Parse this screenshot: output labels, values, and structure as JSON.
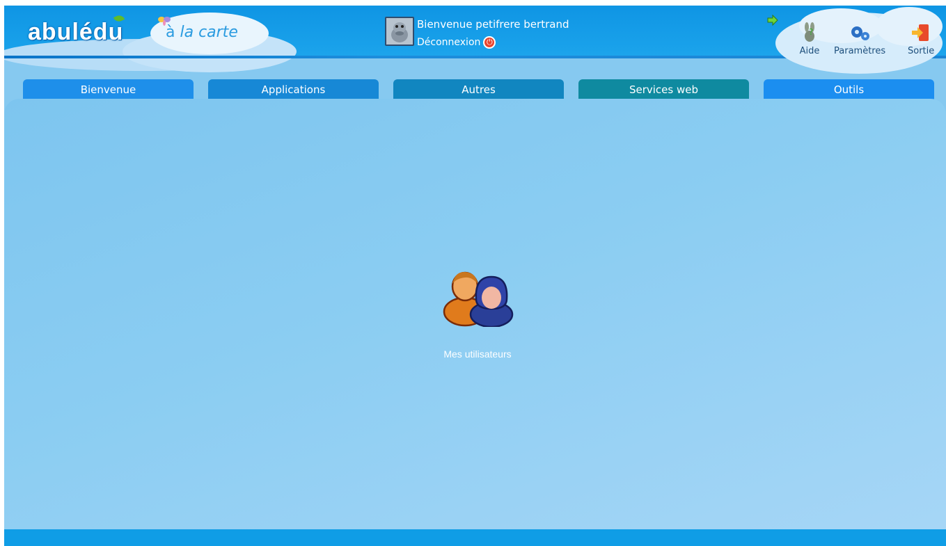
{
  "brand": {
    "logo_text": "abulédu",
    "subtitle_a": "à",
    "subtitle_rest": " la carte"
  },
  "user": {
    "greeting": "Bienvenue petifrere bertrand",
    "logout_label": "Déconnexion"
  },
  "toolbar": {
    "aide_label": "Aide",
    "parametres_label": "Paramètres",
    "sortie_label": "Sortie"
  },
  "nav": {
    "tabs": [
      {
        "label": "Bienvenue",
        "color": "#1e8fea"
      },
      {
        "label": "Applications",
        "color": "#1788d6"
      },
      {
        "label": "Autres",
        "color": "#1186c0"
      },
      {
        "label": "Services web",
        "color": "#0f8aa0"
      },
      {
        "label": "Outils",
        "color": "#1b8ef0"
      }
    ]
  },
  "main": {
    "users_label": "Mes utilisateurs"
  },
  "colors": {
    "header": "#0f95e4",
    "panel": "#86c9f0",
    "footer": "#0f9de6"
  }
}
